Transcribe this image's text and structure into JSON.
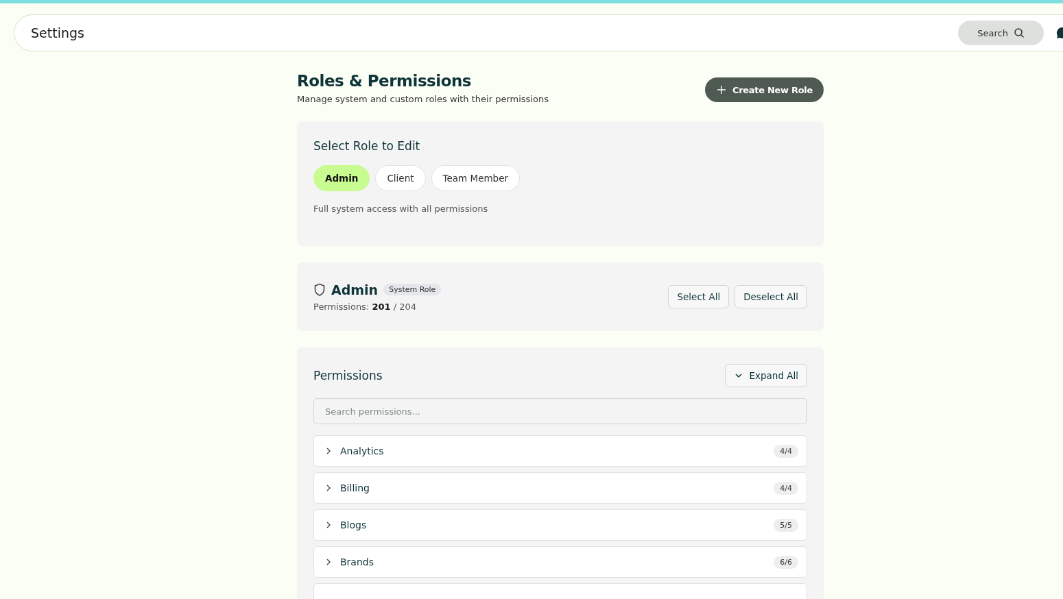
{
  "header": {
    "title": "Settings",
    "search_label": "Search"
  },
  "page": {
    "title": "Roles & Permissions",
    "subtitle": "Manage system and custom roles with their permissions",
    "create_button": "Create New Role"
  },
  "role_picker": {
    "title": "Select Role to Edit",
    "roles": [
      {
        "label": "Admin",
        "selected": true
      },
      {
        "label": "Client",
        "selected": false
      },
      {
        "label": "Team Member",
        "selected": false
      }
    ],
    "description": "Full system access with all permissions"
  },
  "role_summary": {
    "name": "Admin",
    "badge": "System Role",
    "permissions_text": "Permissions: **201** / 204",
    "select_all": "Select All",
    "deselect_all": "Deselect All"
  },
  "permissions": {
    "title": "Permissions",
    "expand_all": "Expand All",
    "search_placeholder": "Search permissions...",
    "groups": [
      {
        "name": "Analytics",
        "count": "4/4",
        "expanded": false
      },
      {
        "name": "Billing",
        "count": "4/4",
        "expanded": false
      },
      {
        "name": "Blogs",
        "count": "5/5",
        "expanded": false
      },
      {
        "name": "Brands",
        "count": "6/6",
        "expanded": false
      }
    ]
  }
}
